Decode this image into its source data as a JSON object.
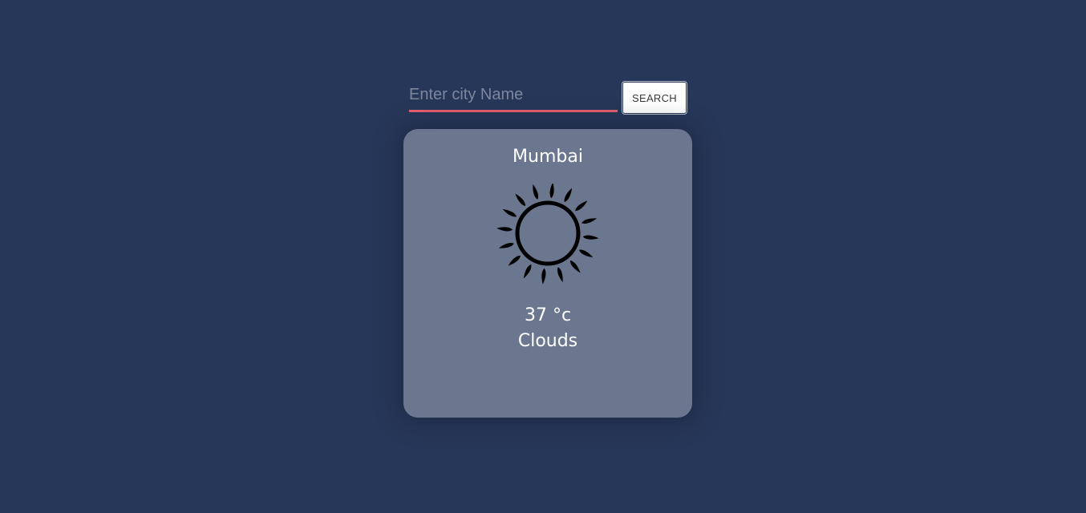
{
  "search": {
    "placeholder": "Enter city Name",
    "value": "",
    "button_label": "SEARCH"
  },
  "weather": {
    "city": "Mumbai",
    "icon": "sun-icon",
    "temperature": "37 °c",
    "condition": "Clouds"
  },
  "colors": {
    "background": "#273759",
    "card": "#6b778e",
    "input_underline": "#e8606e"
  }
}
